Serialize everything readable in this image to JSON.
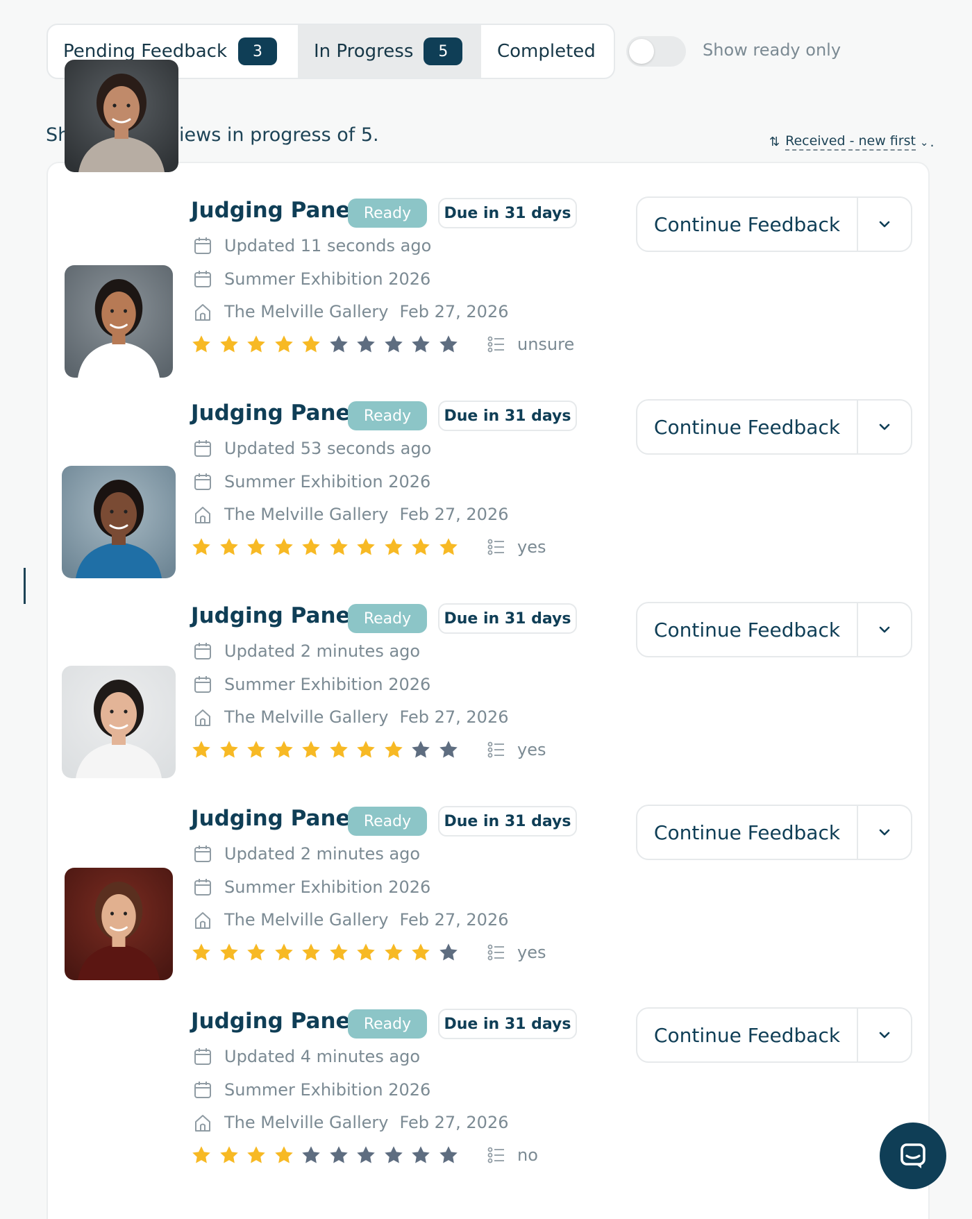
{
  "tabs": [
    {
      "label": "Pending Feedback",
      "count": "3"
    },
    {
      "label": "In Progress",
      "count": "5"
    },
    {
      "label": "Completed"
    }
  ],
  "filter": {
    "label": "Show ready only",
    "on": false
  },
  "summary": "Showing 5 reviews in progress of 5.",
  "sort": {
    "icon": "sort-icon",
    "label": "Received - new first",
    "suffix": "."
  },
  "reviews": [
    {
      "title": "Judging Panel",
      "status": "Ready",
      "due": "Due in 31 days",
      "updated": "Updated 11 seconds ago",
      "event": "Summer Exhibition 2026",
      "venue": "The Melville Gallery",
      "date": "Feb 27, 2026",
      "rating": 5,
      "rating_max": 10,
      "recommendation": "unsure",
      "action": "Continue Feedback"
    },
    {
      "title": "Judging Panel",
      "status": "Ready",
      "due": "Due in 31 days",
      "updated": "Updated 53 seconds ago",
      "event": "Summer Exhibition 2026",
      "venue": "The Melville Gallery",
      "date": "Feb 27, 2026",
      "rating": 10,
      "rating_max": 10,
      "recommendation": "yes",
      "action": "Continue Feedback"
    },
    {
      "title": "Judging Panel",
      "status": "Ready",
      "due": "Due in 31 days",
      "updated": "Updated 2 minutes ago",
      "event": "Summer Exhibition 2026",
      "venue": "The Melville Gallery",
      "date": "Feb 27, 2026",
      "rating": 8,
      "rating_max": 10,
      "recommendation": "yes",
      "action": "Continue Feedback"
    },
    {
      "title": "Judging Panel",
      "status": "Ready",
      "due": "Due in 31 days",
      "updated": "Updated 2 minutes ago",
      "event": "Summer Exhibition 2026",
      "venue": "The Melville Gallery",
      "date": "Feb 27, 2026",
      "rating": 9,
      "rating_max": 10,
      "recommendation": "yes",
      "action": "Continue Feedback"
    },
    {
      "title": "Judging Panel",
      "status": "Ready",
      "due": "Due in 31 days",
      "updated": "Updated 4 minutes ago",
      "event": "Summer Exhibition 2026",
      "venue": "The Melville Gallery",
      "date": "Feb 27, 2026",
      "rating": 4,
      "rating_max": 10,
      "recommendation": "no",
      "action": "Continue Feedback"
    }
  ],
  "colors": {
    "primary": "#0f3e56",
    "ready": "#8cc5c7",
    "star_filled": "#f7b924",
    "star_empty": "#5e6d80",
    "muted": "#7b8a93"
  },
  "icons": {
    "updated": "calendar-icon",
    "event": "calendar-icon",
    "venue": "home-icon",
    "recommendation": "list-icon",
    "dropdown": "chevron-down-icon",
    "chat": "chat-icon"
  }
}
